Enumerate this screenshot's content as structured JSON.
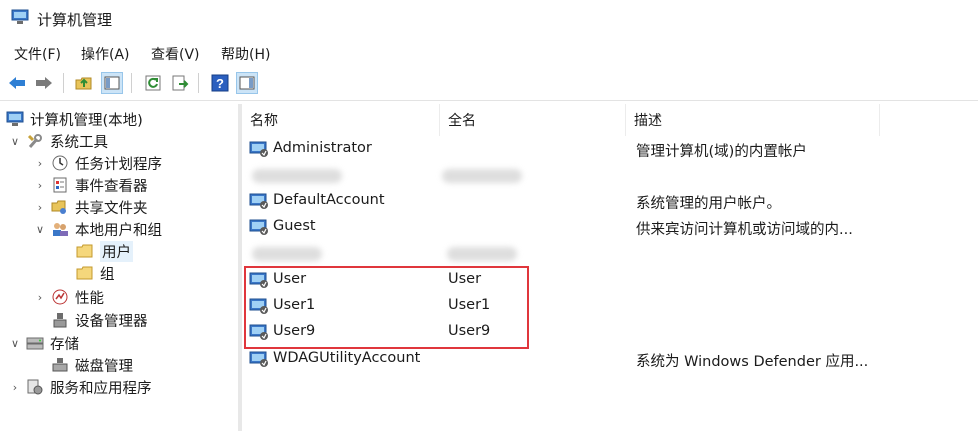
{
  "window": {
    "title": "计算机管理",
    "icon": "computer-management-icon"
  },
  "menu": [
    "文件(F)",
    "操作(A)",
    "查看(V)",
    "帮助(H)"
  ],
  "toolbar": {
    "buttons": [
      "back-arrow-icon",
      "forward-arrow-icon",
      "up-folder-icon",
      "show-hide-tree-icon",
      "refresh-icon",
      "export-list-icon",
      "help-icon",
      "show-hide-action-pane-icon"
    ]
  },
  "tree": {
    "root": "计算机管理(本地)",
    "system_tools": "系统工具",
    "task_scheduler": "任务计划程序",
    "event_viewer": "事件查看器",
    "shared_folders": "共享文件夹",
    "local_users_groups": "本地用户和组",
    "users": "用户",
    "groups": "组",
    "performance": "性能",
    "device_manager": "设备管理器",
    "storage": "存储",
    "disk_management": "磁盘管理",
    "services_apps": "服务和应用程序"
  },
  "list": {
    "columns": {
      "name": "名称",
      "fullname": "全名",
      "description": "描述"
    },
    "rows": [
      {
        "name": "Administrator",
        "fullname": "",
        "description": "管理计算机(域)的内置帐户"
      },
      {
        "name": "",
        "fullname": "",
        "description": ""
      },
      {
        "name": "DefaultAccount",
        "fullname": "",
        "description": "系统管理的用户帐户。"
      },
      {
        "name": "Guest",
        "fullname": "",
        "description": "供来宾访问计算机或访问域的内..."
      },
      {
        "name": "",
        "fullname": "",
        "description": ""
      },
      {
        "name": "User",
        "fullname": "User",
        "description": ""
      },
      {
        "name": "User1",
        "fullname": "User1",
        "description": ""
      },
      {
        "name": "User9",
        "fullname": "User9",
        "description": ""
      },
      {
        "name": "WDAGUtilityAccount",
        "fullname": "",
        "description": "系统为 Windows Defender 应用..."
      }
    ]
  },
  "colors": {
    "highlight_border": "#e0363c",
    "selection": "#e5f1fb"
  }
}
